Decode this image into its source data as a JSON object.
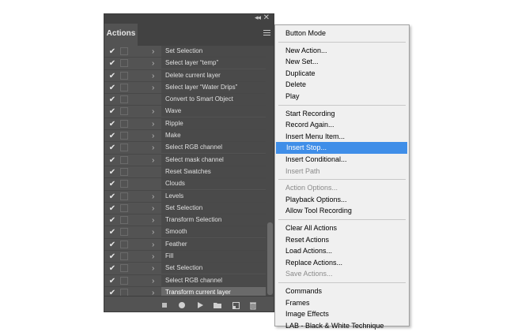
{
  "panel": {
    "tab_label": "Actions",
    "collapse_glyph": "◂◂",
    "close_glyph": "✕",
    "rows": [
      {
        "label": "Set Selection",
        "chevron": true
      },
      {
        "label": "Select layer “temp”",
        "chevron": true
      },
      {
        "label": "Delete current layer",
        "chevron": true
      },
      {
        "label": "Select layer “Water Drips”",
        "chevron": true
      },
      {
        "label": "Convert to Smart Object",
        "chevron": false
      },
      {
        "label": "Wave",
        "chevron": true
      },
      {
        "label": "Ripple",
        "chevron": true
      },
      {
        "label": "Make",
        "chevron": true
      },
      {
        "label": "Select RGB channel",
        "chevron": true
      },
      {
        "label": "Select mask channel",
        "chevron": true
      },
      {
        "label": "Reset Swatches",
        "chevron": false
      },
      {
        "label": "Clouds",
        "chevron": false
      },
      {
        "label": "Levels",
        "chevron": true
      },
      {
        "label": "Set Selection",
        "chevron": true
      },
      {
        "label": "Transform Selection",
        "chevron": true
      },
      {
        "label": "Smooth",
        "chevron": true
      },
      {
        "label": "Feather",
        "chevron": true
      },
      {
        "label": "Fill",
        "chevron": true
      },
      {
        "label": "Set Selection",
        "chevron": true
      },
      {
        "label": "Select RGB channel",
        "chevron": true
      },
      {
        "label": "Transform current layer",
        "chevron": true,
        "selected": true
      }
    ],
    "check_glyph": "✔",
    "chevron_glyph": "›",
    "bottom_icons": [
      "stop-icon",
      "record-icon",
      "play-icon",
      "folder-icon",
      "new-item-icon",
      "trash-icon"
    ]
  },
  "menu": {
    "groups": [
      [
        {
          "label": "Button Mode"
        }
      ],
      [
        {
          "label": "New Action..."
        },
        {
          "label": "New Set..."
        },
        {
          "label": "Duplicate"
        },
        {
          "label": "Delete"
        },
        {
          "label": "Play"
        }
      ],
      [
        {
          "label": "Start Recording"
        },
        {
          "label": "Record Again..."
        },
        {
          "label": "Insert Menu Item..."
        },
        {
          "label": "Insert Stop...",
          "highlight": true
        },
        {
          "label": "Insert Conditional..."
        },
        {
          "label": "Insert Path",
          "disabled": true
        }
      ],
      [
        {
          "label": "Action Options...",
          "disabled": true
        },
        {
          "label": "Playback Options..."
        },
        {
          "label": "Allow Tool Recording"
        }
      ],
      [
        {
          "label": "Clear All Actions"
        },
        {
          "label": "Reset Actions"
        },
        {
          "label": "Load Actions..."
        },
        {
          "label": "Replace Actions..."
        },
        {
          "label": "Save Actions...",
          "disabled": true
        }
      ],
      [
        {
          "label": "Commands"
        },
        {
          "label": "Frames"
        },
        {
          "label": "Image Effects"
        },
        {
          "label": "LAB - Black & White Technique"
        }
      ]
    ]
  },
  "colors": {
    "panel_bg": "#535353",
    "menu_bg": "#f0f0f0",
    "highlight": "#3f8ee8"
  }
}
